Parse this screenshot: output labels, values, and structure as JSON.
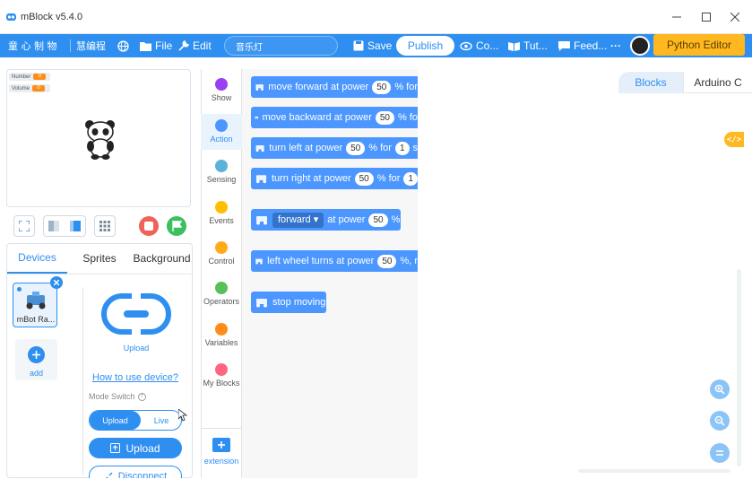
{
  "window": {
    "title": "mBlock v5.4.0",
    "controls": [
      "minimize-icon",
      "maximize-icon",
      "close-icon"
    ]
  },
  "menubar": {
    "logo_text": "童 心 制 物",
    "brand_text": "慧编程",
    "file": "File",
    "edit": "Edit",
    "project_name": "音乐灯",
    "save": "Save",
    "publish": "Publish",
    "courses": "Co...",
    "tutorials": "Tut...",
    "feedback": "Feed...",
    "more": "···",
    "python_editor": "Python Editor",
    "accent_color": "#2e8ff0",
    "python_color": "#ffb81f"
  },
  "stage": {
    "monitors": [
      {
        "label": "Number",
        "value": "0"
      },
      {
        "label": "Volume",
        "value": "0"
      }
    ]
  },
  "devices_panel": {
    "tabs": [
      "Devices",
      "Sprites",
      "Background"
    ],
    "active_tab": "Devices",
    "device_name": "mBot Ra...",
    "add_label": "add",
    "upload_icon_label": "Upload",
    "how_to_link": "How to use device?",
    "mode_switch_label": "Mode Switch",
    "mode_upload": "Upload",
    "mode_live": "Live",
    "upload_button": "Upload",
    "disconnect_button": "Disconnect"
  },
  "categories": [
    {
      "label": "Show",
      "color": "#9a3ff2"
    },
    {
      "label": "Action",
      "color": "#4c97ff"
    },
    {
      "label": "Sensing",
      "color": "#5cb1d6"
    },
    {
      "label": "Events",
      "color": "#ffbf00"
    },
    {
      "label": "Control",
      "color": "#ffab19"
    },
    {
      "label": "Operators",
      "color": "#59c059"
    },
    {
      "label": "Variables",
      "color": "#ff8c1a"
    },
    {
      "label": "My Blocks",
      "color": "#ff6680"
    }
  ],
  "extension_label": "extension",
  "blocks": [
    {
      "pre": "move forward at power",
      "value": "50",
      "post": "% for"
    },
    {
      "pre": "move backward at power",
      "value": "50",
      "post": "% fo"
    },
    {
      "pre": "turn left at power",
      "value": "50",
      "post": "% for",
      "value2": "1",
      "post2": "s"
    },
    {
      "pre": "turn right at power",
      "value": "50",
      "post": "% for",
      "value2": "1"
    },
    {
      "dropdown": "forward ▾",
      "pre": "at power",
      "value": "50",
      "post": "%"
    },
    {
      "pre": "left wheel turns at power",
      "value": "50",
      "post": "%, r"
    },
    {
      "pre": "stop moving"
    }
  ],
  "workspace": {
    "tabs": [
      "Blocks",
      "Arduino C"
    ],
    "active_tab": "Blocks",
    "code_toggle": "</>"
  }
}
